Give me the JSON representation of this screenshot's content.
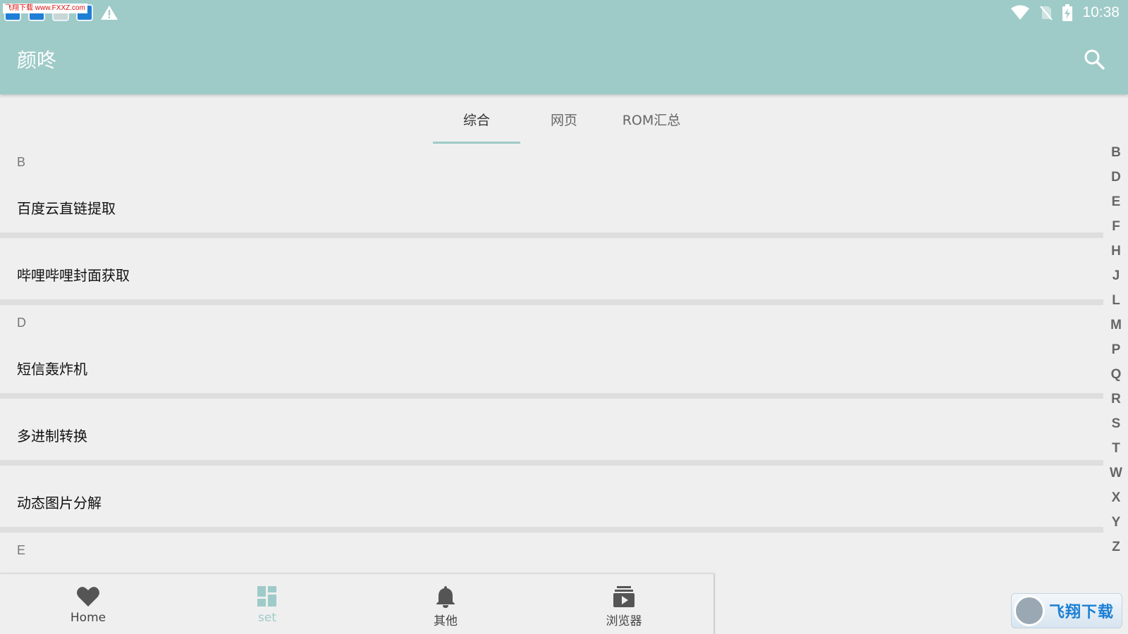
{
  "status_bar": {
    "watermark": "飞翔下载 www.FXXZ.com",
    "time": "10:38",
    "icons": [
      "app-notification-icon",
      "app-notification-icon",
      "image-notification-icon",
      "video-notification-icon",
      "warning-icon",
      "wifi-icon",
      "no-sim-icon",
      "battery-charging-icon"
    ]
  },
  "toolbar": {
    "title": "颜咚",
    "search_icon": "search-icon"
  },
  "tabs": [
    {
      "label": "综合",
      "active": true
    },
    {
      "label": "网页",
      "active": false
    },
    {
      "label": "ROM汇总",
      "active": false
    }
  ],
  "list": {
    "section_b": "B",
    "item_baidu": "百度云直链提取",
    "item_bilibili": "哔哩哔哩封面获取",
    "section_d": "D",
    "item_sms": "短信轰炸机",
    "item_base": "多进制转换",
    "item_gif": "动态图片分解",
    "section_e": "E"
  },
  "index_letters": [
    "B",
    "D",
    "E",
    "F",
    "H",
    "J",
    "L",
    "M",
    "P",
    "Q",
    "R",
    "S",
    "T",
    "W",
    "X",
    "Y",
    "Z"
  ],
  "bottom_nav": [
    {
      "label": "Home",
      "icon": "heart-icon",
      "active": true
    },
    {
      "label": "set",
      "icon": "dashboard-icon",
      "active": false
    },
    {
      "label": "其他",
      "icon": "bell-icon",
      "active": true
    },
    {
      "label": "浏览器",
      "icon": "browser-icon",
      "active": true
    }
  ],
  "corner_logo": {
    "text": "飞翔下载",
    "url_text": "www.FXXZ.com"
  },
  "colors": {
    "accent": "#9ecbc8",
    "background": "#efefef",
    "divider": "#dedede"
  }
}
